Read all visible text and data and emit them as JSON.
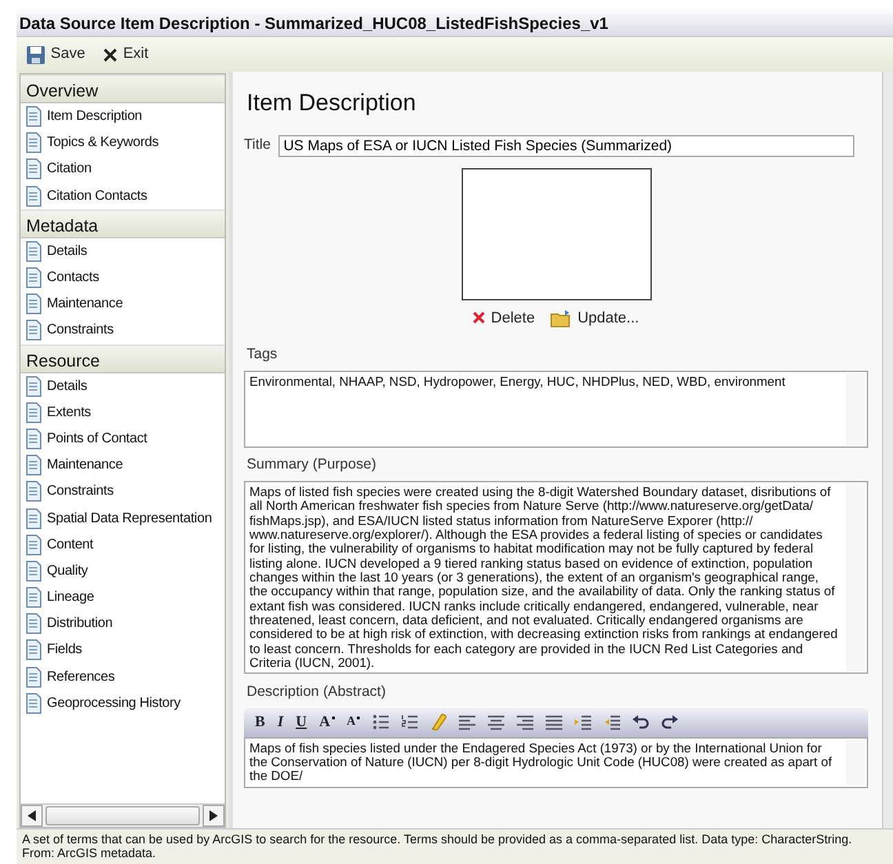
{
  "window": {
    "title": "Data Source Item Description - Summarized_HUC08_ListedFishSpecies_v1"
  },
  "toolbar": [
    {
      "kind": "save",
      "label": "Save"
    },
    {
      "kind": "exit",
      "label": "Exit"
    }
  ],
  "sidebar": [
    {
      "header": "Overview",
      "items": [
        "Item Description",
        "Topics & Keywords",
        "Citation",
        "Citation Contacts"
      ]
    },
    {
      "header": "Metadata",
      "items": [
        "Details",
        "Contacts",
        "Maintenance",
        "Constraints"
      ]
    },
    {
      "header": "Resource",
      "items": [
        "Details",
        "Extents",
        "Points of Contact",
        "Maintenance",
        "Constraints",
        "Spatial Data Representation",
        "Content",
        "Quality",
        "Lineage",
        "Distribution",
        "Fields",
        "References",
        "Geoprocessing History"
      ]
    }
  ],
  "content": {
    "heading": "Item Description",
    "title_label": "Title",
    "title_value": "US Maps of ESA or IUCN Listed Fish Species (Summarized)",
    "thumbnail_actions": [
      {
        "kind": "delete",
        "label": "Delete"
      },
      {
        "kind": "update",
        "label": "Update..."
      }
    ],
    "tags_label": "Tags",
    "tags_value": "Environmental, NHAAP, NSD, Hydropower, Energy, HUC, NHDPlus, NED, WBD, environment",
    "summary_label": "Summary (Purpose)",
    "summary_value": "Maps of listed fish species were created using the 8-digit Watershed Boundary dataset, disributions of all North American freshwater fish species from Nature Serve (http://www.natureserve.org/getData/ fishMaps.jsp), and ESA/IUCN listed status information from NatureServe Exporer (http:// www.natureserve.org/explorer/). Although the ESA provides a federal listing of species or candidates for listing, the vulnerability of organisms to habitat modification may not be fully captured by federal listing alone. IUCN developed a 9 tiered ranking status based on evidence of extinction, population changes within the last 10 years (or 3 generations), the extent of an organism's geographical range, the occupancy within that range, population size, and the availability of data. Only the ranking status of extant fish was considered. IUCN ranks include critically endangered, endangered, vulnerable, near threatened, least concern, data deficient, and not evaluated. Critically endangered organisms are considered to be at high risk of extinction, with decreasing extinction risks from rankings at endangered to least concern. Thresholds for each category are provided in the IUCN Red List Categories and Criteria (IUCN, 2001).",
    "description_label": "Description (Abstract)",
    "editor_tools": [
      {
        "kind": "bold",
        "label": "B"
      },
      {
        "kind": "italic",
        "label": "I"
      },
      {
        "kind": "underline",
        "label": "U"
      },
      {
        "kind": "grow",
        "label": "A"
      },
      {
        "kind": "shrink",
        "label": "A"
      },
      {
        "kind": "bullets"
      },
      {
        "kind": "numbers"
      },
      {
        "kind": "highlight"
      },
      {
        "kind": "align-left"
      },
      {
        "kind": "align-center"
      },
      {
        "kind": "align-right"
      },
      {
        "kind": "justify"
      },
      {
        "kind": "indent"
      },
      {
        "kind": "outdent"
      },
      {
        "kind": "undo"
      },
      {
        "kind": "redo"
      }
    ],
    "description_value": "Maps of fish species listed under the Endagered Species Act (1973) or by the International Union for the Conservation of Nature (IUCN) per 8-digit Hydrologic Unit Code (HUC08) were created as apart of the DOE/"
  },
  "status_bar": "A set of terms that can be used by ArcGIS to search for the resource. Terms should be provided as a comma-separated list. Data type: CharacterString. From: ArcGIS metadata."
}
